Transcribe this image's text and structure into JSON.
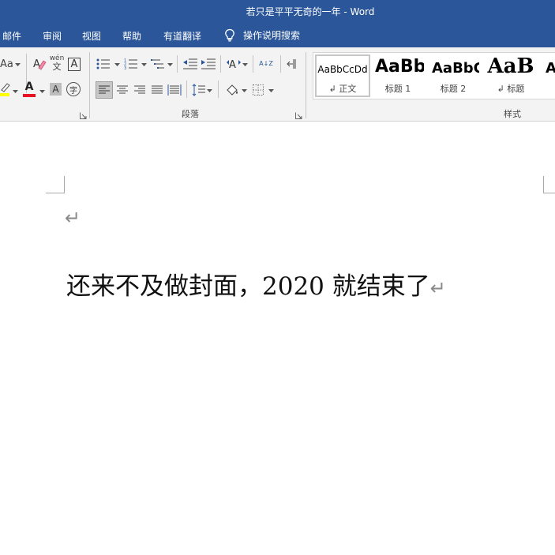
{
  "window": {
    "title": "若只是平平无奇的一年  -  Word"
  },
  "tabs": [
    "邮件",
    "审阅",
    "视图",
    "帮助",
    "有道翻译"
  ],
  "tell_me": {
    "label": "操作说明搜索",
    "icon": "lightbulb-icon"
  },
  "ribbon": {
    "font_group": {
      "change_case_label": "Aa",
      "clear_formatting_icon": "clear-formatting-icon",
      "phonetic_guide_label": "wén",
      "phonetic_guide_sub": "文",
      "character_border_label": "A",
      "highlight_icon": "highlighter-icon",
      "highlight_color": "#ffff00",
      "font_color_label": "A",
      "font_color": "#e81123",
      "character_shading_label": "A",
      "enclose_characters_label": "字"
    },
    "paragraph_group": {
      "label": "段落",
      "sort_label": "A↓Z"
    },
    "styles_group": {
      "label": "样式",
      "items": [
        {
          "sample": "AaBbCcDd",
          "name": "↲ 正文",
          "selected": true
        },
        {
          "sample": "AaBb",
          "name": "标题 1"
        },
        {
          "sample": "AaBbC",
          "name": "标题 2"
        },
        {
          "sample": "AaB",
          "name": "↲ 标题"
        },
        {
          "sample": "A",
          "name": ""
        }
      ]
    }
  },
  "document": {
    "empty_paragraph_mark": "↵",
    "body_text": "还来不及做封面，2020 就结束了",
    "body_paragraph_mark": "↵"
  },
  "colors": {
    "title_bar": "#2b579a",
    "ribbon_background": "#f3f3f3",
    "document_background": "#ffffff"
  }
}
